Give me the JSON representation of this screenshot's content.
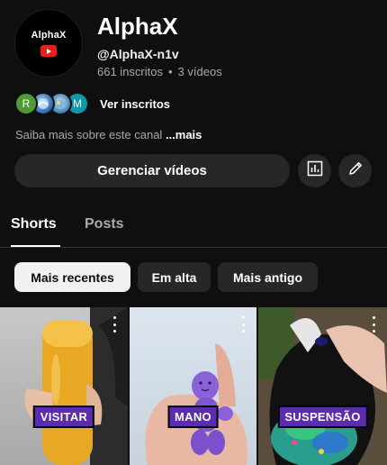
{
  "channel": {
    "avatar_text": "AlphaX",
    "name": "AlphaX",
    "handle": "@AlphaX-n1v",
    "subscribers": "661 inscritos",
    "separator": "•",
    "videos": "3 vídeos"
  },
  "subscribers_preview": {
    "avatars": [
      {
        "initial": "R",
        "color": "#4f9a35"
      },
      {
        "initial": "",
        "color": "#2b64a8"
      },
      {
        "initial": "",
        "color": "#3b7fb0"
      },
      {
        "initial": "M",
        "color": "#0e9aa7"
      }
    ],
    "see_label": "Ver inscritos"
  },
  "about": {
    "text": "Saiba mais sobre este canal",
    "more": "...mais"
  },
  "actions": {
    "manage_label": "Gerenciar vídeos",
    "analytics_icon": "analytics-icon",
    "edit_icon": "pencil-icon"
  },
  "tabs": [
    {
      "label": "Shorts",
      "active": true
    },
    {
      "label": "Posts",
      "active": false
    }
  ],
  "filters": [
    {
      "label": "Mais recentes",
      "active": true
    },
    {
      "label": "Em alta",
      "active": false
    },
    {
      "label": "Mais antigo",
      "active": false
    }
  ],
  "shorts": [
    {
      "label": "VISITAR"
    },
    {
      "label": "MANO"
    },
    {
      "label": "SUSPENSÃO"
    }
  ]
}
